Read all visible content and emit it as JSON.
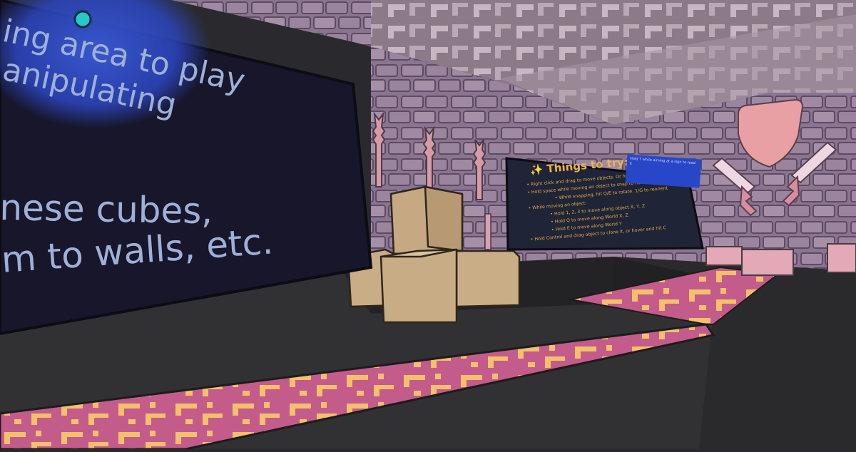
{
  "scene": {
    "left_sign": {
      "lines": [
        "ing area to play",
        "anipulating",
        "nese cubes,",
        "m to walls, etc."
      ]
    },
    "things_to_try": {
      "title": "Things to try:",
      "icon": "sparkles-icon",
      "items": [
        "• Right click and drag to move objects. Or hold TAB",
        "• Hold space while moving an object to snap to floor",
        "• While snapping, hit Q/E to rotate. 1/G to reorient",
        "• While moving an object:",
        "• Hold 1, 2, 3 to move along object X, Y, Z",
        "• Hold Q to move along World X, Z",
        "• Hold E to move along World Y",
        "• Hold Control and drag object to clone it, or hover and hit C"
      ]
    },
    "tooltip": {
      "text": "Hold T while aiming at a sign to read it"
    },
    "colors": {
      "wall": "#8e7990",
      "ceiling": "#9c8998",
      "floor": "#313133",
      "carpet": "#c35c8a",
      "carpet_pattern": "#f3c06c",
      "box": "#c9ad86",
      "sign_bg": "#17162a",
      "sign_text": "#9fb0d8",
      "accent_text": "#e8b54a",
      "tooltip_bg": "#2747c8"
    }
  }
}
